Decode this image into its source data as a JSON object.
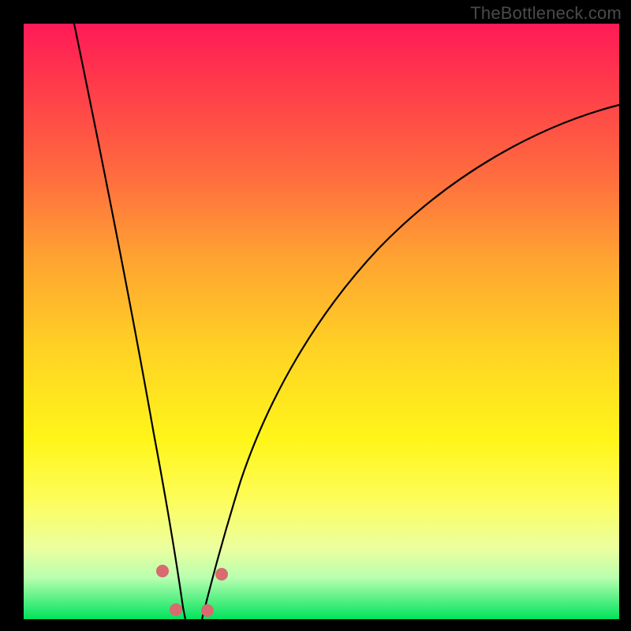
{
  "watermark": "TheBottleneck.com",
  "chart_data": {
    "type": "line",
    "title": "",
    "xlabel": "",
    "ylabel": "",
    "xlim": [
      0,
      100
    ],
    "ylim": [
      0,
      100
    ],
    "grid": false,
    "legend": false,
    "series": [
      {
        "name": "left-branch",
        "x": [
          8.5,
          10,
          12,
          14,
          16,
          18,
          20,
          21,
          22,
          23,
          24,
          25,
          25.5,
          26,
          27
        ],
        "y": [
          100,
          88,
          73,
          59,
          46,
          34,
          23,
          18,
          13.5,
          9.5,
          6,
          3,
          1.8,
          0.8,
          0
        ]
      },
      {
        "name": "right-branch",
        "x": [
          30,
          31,
          32,
          33,
          34,
          36,
          38,
          40,
          44,
          48,
          52,
          58,
          64,
          72,
          80,
          90,
          100
        ],
        "y": [
          0,
          1.5,
          3.5,
          6,
          9,
          15,
          21,
          27,
          37,
          45,
          52,
          60,
          66,
          72,
          77,
          82,
          86
        ]
      }
    ],
    "markers": [
      {
        "name": "left-upper-dot",
        "x": 23.3,
        "y": 8.0
      },
      {
        "name": "left-lower-dot",
        "x": 25.6,
        "y": 1.6
      },
      {
        "name": "right-lower-dot",
        "x": 30.9,
        "y": 1.4
      },
      {
        "name": "right-upper-dot",
        "x": 33.2,
        "y": 7.7
      }
    ],
    "background_gradient": {
      "top": "#ff1a57",
      "mid": "#fff61a",
      "bottom": "#00e35d"
    },
    "frame_color": "#000000"
  }
}
